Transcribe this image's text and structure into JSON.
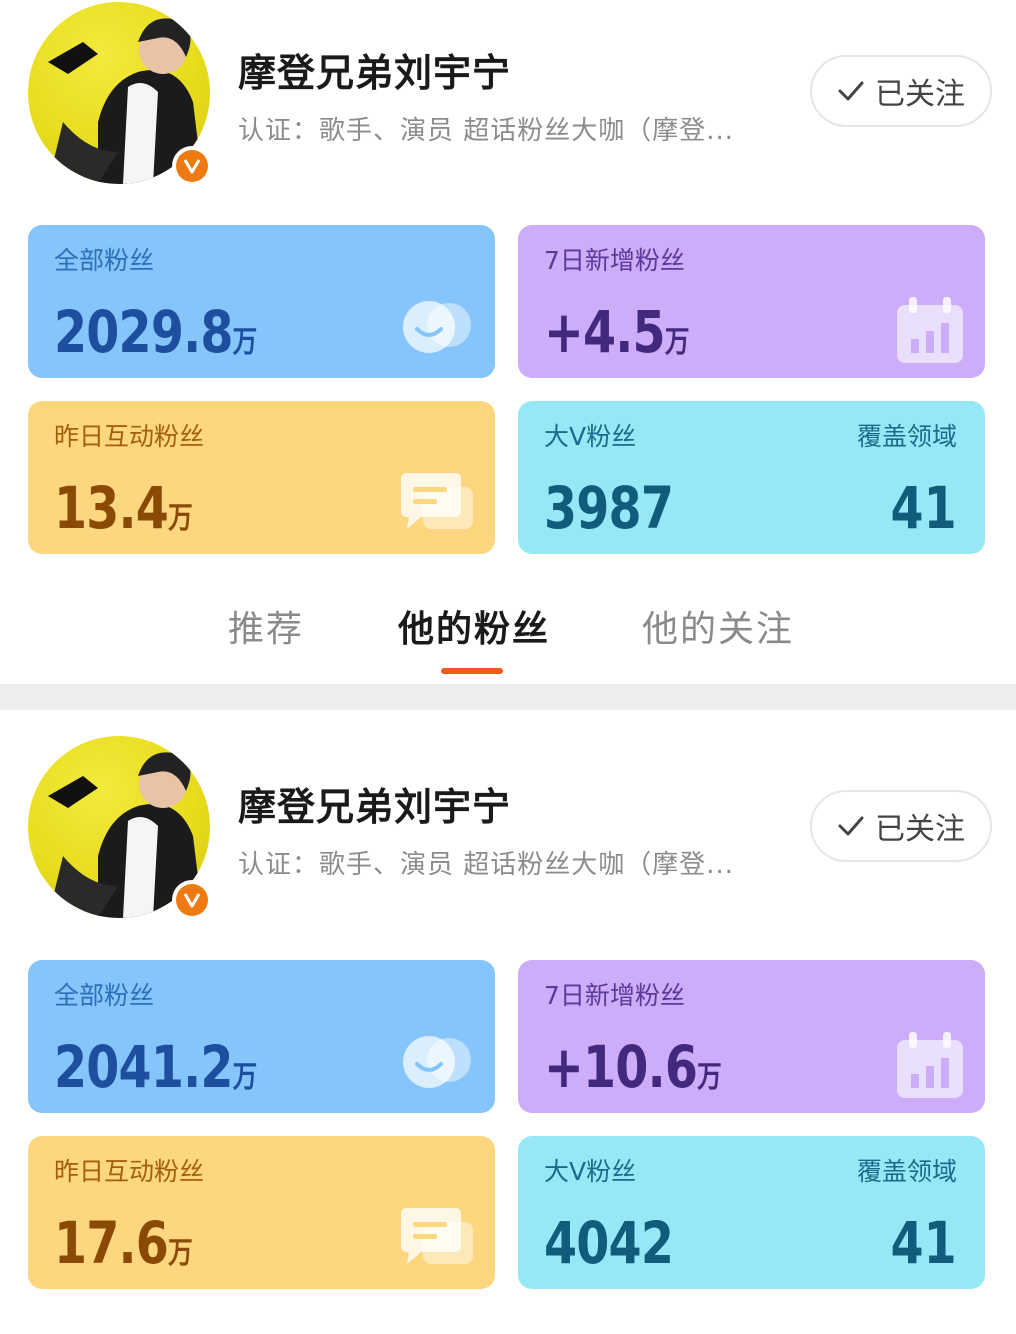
{
  "profiles": [
    {
      "name": "摩登兄弟刘宇宁",
      "verification": "认证：歌手、演员 超话粉丝大咖（摩登...",
      "follow_label": "已关注",
      "stats": {
        "total_fans": {
          "label": "全部粉丝",
          "number": "2029.8",
          "unit": "万"
        },
        "new_fans_7d": {
          "label": "7日新增粉丝",
          "number": "+4.5",
          "unit": "万"
        },
        "interactive_fans": {
          "label": "昨日互动粉丝",
          "number": "13.4",
          "unit": "万"
        },
        "bigv_fans": {
          "label": "大V粉丝",
          "number": "3987",
          "coverage_label": "覆盖领域",
          "coverage_value": "41"
        }
      }
    },
    {
      "name": "摩登兄弟刘宇宁",
      "verification": "认证：歌手、演员 超话粉丝大咖（摩登...",
      "follow_label": "已关注",
      "stats": {
        "total_fans": {
          "label": "全部粉丝",
          "number": "2041.2",
          "unit": "万"
        },
        "new_fans_7d": {
          "label": "7日新增粉丝",
          "number": "+10.6",
          "unit": "万"
        },
        "interactive_fans": {
          "label": "昨日互动粉丝",
          "number": "17.6",
          "unit": "万"
        },
        "bigv_fans": {
          "label": "大V粉丝",
          "number": "4042",
          "coverage_label": "覆盖领域",
          "coverage_value": "41"
        }
      }
    }
  ],
  "tabs": [
    {
      "label": "推荐",
      "active": false
    },
    {
      "label": "他的粉丝",
      "active": true
    },
    {
      "label": "他的关注",
      "active": false
    }
  ],
  "colors": {
    "accent": "#ef5a1c",
    "verified_badge": "#f07a12",
    "card_blue": "#85c5fb",
    "card_purple": "#cbadf9",
    "card_yellow": "#fcd77f",
    "card_cyan": "#96e8f6"
  },
  "icons": [
    "fans-icon",
    "calendar-chart-icon",
    "chat-bubble-icon",
    "verified-v-icon",
    "checkmark-icon"
  ]
}
